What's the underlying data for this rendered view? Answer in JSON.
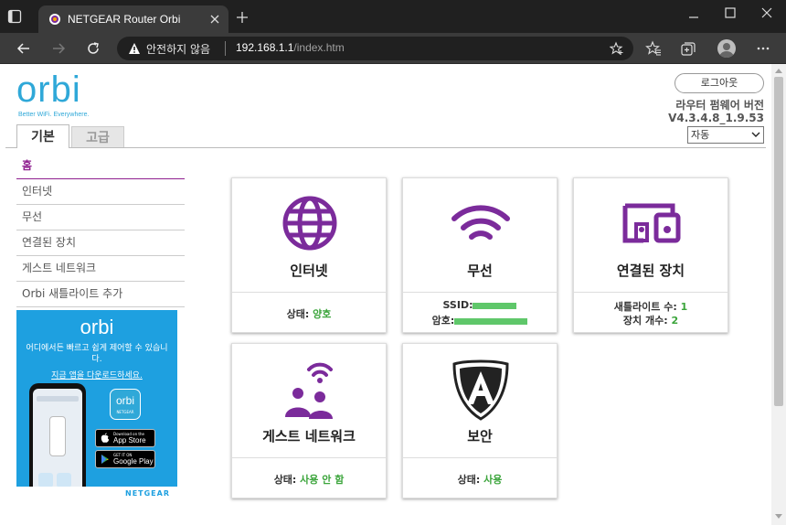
{
  "browser": {
    "tab_title": "NETGEAR Router Orbi",
    "security_label": "안전하지 않음",
    "url_host": "192.168.1.1",
    "url_path": "/index.htm"
  },
  "header": {
    "logo_word": "orbi",
    "logo_tagline": "Better WiFi. Everywhere.",
    "tabs": {
      "basic": "기본",
      "advanced": "고급"
    },
    "logout_label": "로그아웃",
    "firmware_label": "라우터 펌웨어 버전",
    "firmware_version": "V4.3.4.8_1.9.53",
    "language_selected": "자동"
  },
  "sidebar": {
    "items": [
      {
        "label": "홈"
      },
      {
        "label": "인터넷"
      },
      {
        "label": "무선"
      },
      {
        "label": "연결된 장치"
      },
      {
        "label": "게스트 네트워크"
      },
      {
        "label": "Orbi 새틀라이트 추가"
      }
    ]
  },
  "promo": {
    "logo": "orbi",
    "text": "어디에서든 빠르고 쉽게 제어할 수 있습니다.",
    "link": "지금 앱을 다운로드하세요.",
    "app_icon_word": "orbi",
    "app_icon_sub": "NETGEAR",
    "appstore_small": "Download on the",
    "appstore_big": "App Store",
    "googleplay_small": "GET IT ON",
    "googleplay_big": "Google Play",
    "brand": "NETGEAR"
  },
  "tiles": {
    "internet": {
      "title": "인터넷",
      "status_label": "상태:",
      "status_value": "양호"
    },
    "wireless": {
      "title": "무선",
      "ssid_label": "SSID:",
      "password_label": "암호:"
    },
    "devices": {
      "title": "연결된 장치",
      "satellites_label": "새틀라이트 수:",
      "satellites_value": "1",
      "devices_label": "장치 개수:",
      "devices_value": "2"
    },
    "guest": {
      "title": "게스트 네트워크",
      "status_label": "상태:",
      "status_value": "사용 안 함"
    },
    "security": {
      "title": "보안",
      "status_label": "상태:",
      "status_value": "사용"
    }
  },
  "colors": {
    "accent_purple": "#7b2b9b",
    "status_green": "#3ca53c",
    "orbi_blue": "#2fa8d8",
    "menu_active": "#8f1f8f"
  }
}
